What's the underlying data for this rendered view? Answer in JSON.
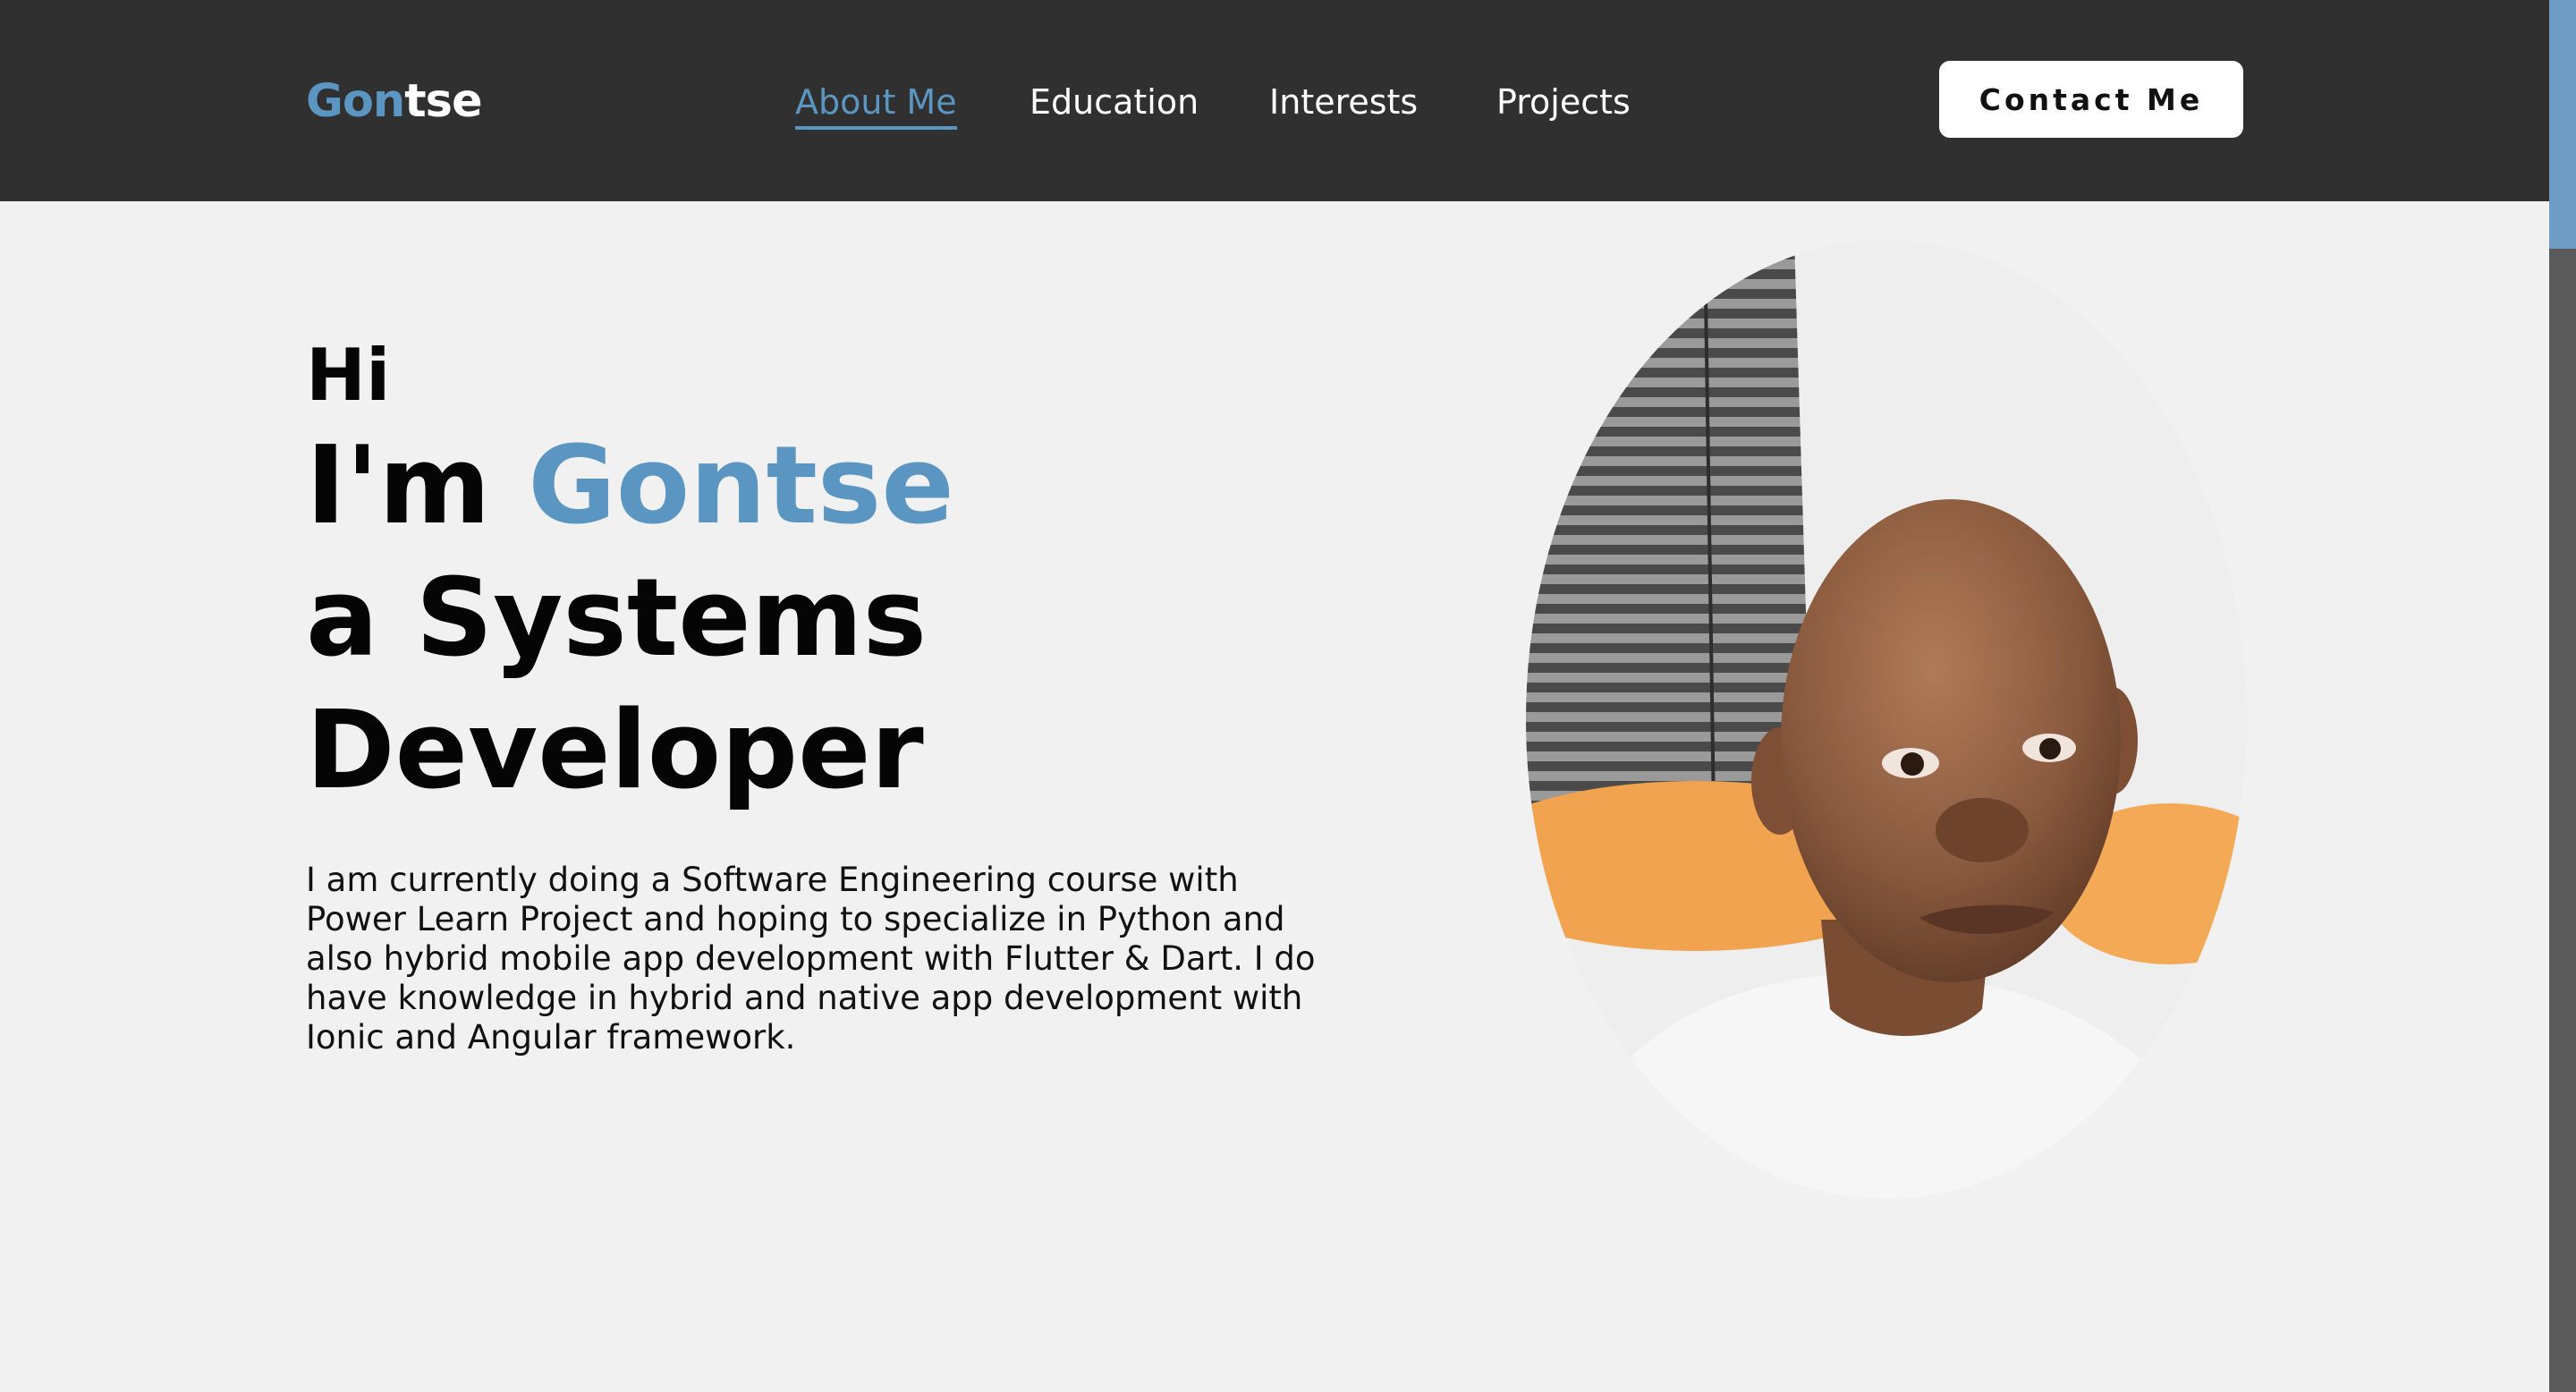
{
  "header": {
    "logo_part1": "Gon",
    "logo_part2": "tse",
    "nav": [
      {
        "label": "About Me",
        "active": true
      },
      {
        "label": "Education",
        "active": false
      },
      {
        "label": "Interests",
        "active": false
      },
      {
        "label": "Projects",
        "active": false
      }
    ],
    "contact_label": "Contact Me"
  },
  "hero": {
    "greeting": "Hi",
    "intro_prefix": "I'm ",
    "name": "Gontse",
    "role_line1": "a Systems",
    "role_line2": "Developer",
    "bio": "I am currently doing a Software Engineering course with Power Learn Project and hoping to specialize in Python and also hybrid mobile app development with Flutter & Dart. I do have knowledge in hybrid and native app development with Ionic and Angular framework."
  },
  "colors": {
    "accent": "#5b96c2",
    "header_bg": "#303030",
    "page_bg": "#f1f1f1"
  }
}
